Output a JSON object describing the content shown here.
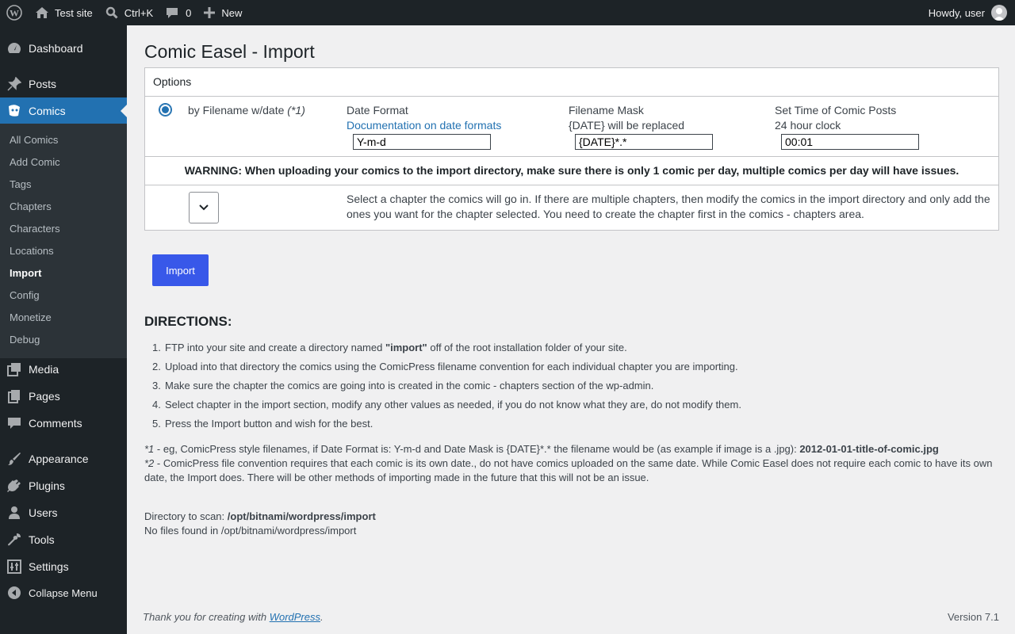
{
  "adminbar": {
    "site_name": "Test site",
    "search_shortcut": "Ctrl+K",
    "comments_count": "0",
    "new_label": "New",
    "howdy": "Howdy, user"
  },
  "sidebar": {
    "dashboard": "Dashboard",
    "posts": "Posts",
    "comics": "Comics",
    "submenu": [
      "All Comics",
      "Add Comic",
      "Tags",
      "Chapters",
      "Characters",
      "Locations",
      "Import",
      "Config",
      "Monetize",
      "Debug"
    ],
    "media": "Media",
    "pages": "Pages",
    "comments": "Comments",
    "appearance": "Appearance",
    "plugins": "Plugins",
    "users": "Users",
    "tools": "Tools",
    "settings": "Settings",
    "collapse": "Collapse Menu"
  },
  "page": {
    "title": "Comic Easel - Import",
    "options_header": "Options",
    "by_filename_label": "by Filename w/date ",
    "by_filename_note": "(*1)",
    "date_format_label": "Date Format",
    "date_format_link": "Documentation on date formats",
    "date_format_value": "Y-m-d",
    "filename_mask_label": "Filename Mask",
    "filename_mask_hint": "{DATE} will be replaced",
    "filename_mask_value": "{DATE}*.*",
    "time_label": "Set Time of Comic Posts",
    "time_hint": "24 hour clock",
    "time_value": "00:01",
    "warning": "WARNING: When uploading your comics to the import directory, make sure there is only 1 comic per day, multiple comics per day will have issues.",
    "chapter_text": "Select a chapter the comics will go in. If there are multiple chapters, then modify the comics in the import directory and only add the ones you want for the chapter selected. You need to create the chapter first in the comics - chapters area.",
    "import_button": "Import"
  },
  "directions": {
    "title": "DIRECTIONS:",
    "step1_a": "FTP into your site and create a directory named ",
    "step1_b": "\"import\"",
    "step1_c": " off of the root installation folder of your site.",
    "step2": "Upload into that directory the comics using the ComicPress filename convention for each individual chapter you are importing.",
    "step3": "Make sure the chapter the comics are going into is created in the comic - chapters section of the wp-admin.",
    "step4": "Select chapter in the import section, modify any other values as needed, if you do not know what they are, do not modify them.",
    "step5": "Press the Import button and wish for the best."
  },
  "notes": {
    "n1_tag": "*1",
    "n1_text": " - eg, ComicPress style filenames, if Date Format is: Y-m-d and Date Mask is {DATE}*.* the filename would be (as example if image is a .jpg): ",
    "n1_example": "2012-01-01-title-of-comic.jpg",
    "n2_tag": "*2",
    "n2_text": " - ComicPress file convention requires that each comic is its own date., do not have comics uploaded on the same date. While Comic Easel does not require each comic to have its own date, the Import does. There will be other methods of importing made in the future that this will not be an issue."
  },
  "scan": {
    "label": "Directory to scan: ",
    "path": "/opt/bitnami/wordpress/import",
    "no_files": "No files found in /opt/bitnami/wordpress/import"
  },
  "footer": {
    "thanks_prefix": "Thank you for creating with ",
    "thanks_link": "WordPress",
    "thanks_suffix": ".",
    "version": "Version 7.1"
  }
}
